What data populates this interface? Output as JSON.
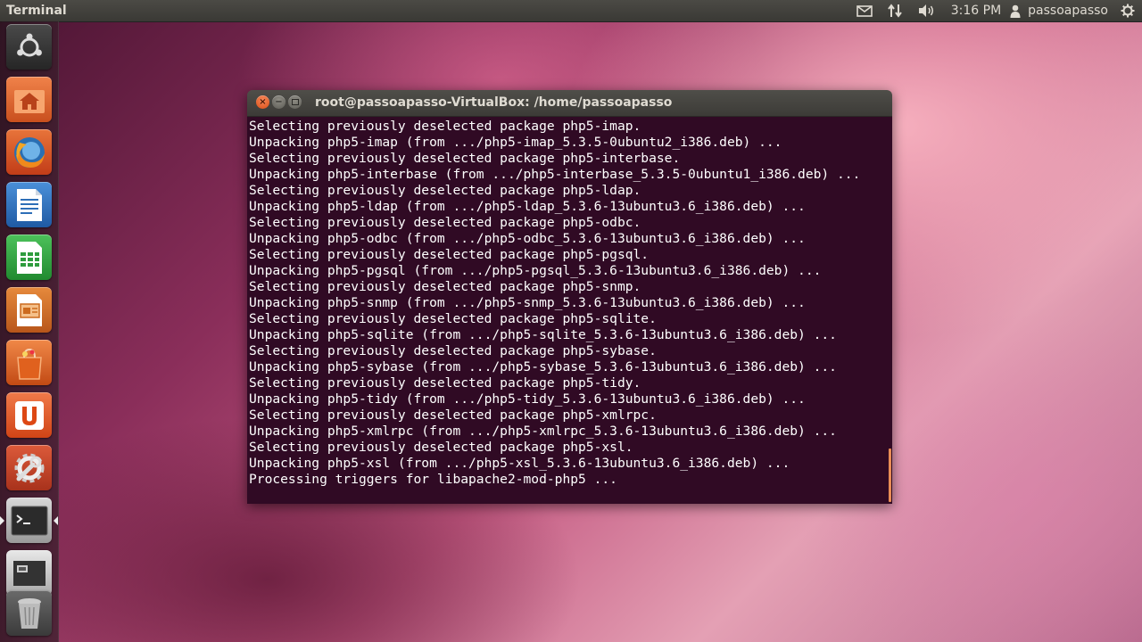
{
  "top_panel": {
    "app_title": "Terminal",
    "clock": "3:16 PM",
    "user": "passoapasso",
    "icons": [
      "mail-icon",
      "network-icon",
      "volume-icon",
      "user-icon",
      "gear-icon"
    ]
  },
  "launcher": {
    "items": [
      {
        "name": "dash-home",
        "icon": "ubuntu-logo-icon",
        "color": "#2b2b2b"
      },
      {
        "name": "home-folder",
        "icon": "home-folder-icon",
        "color": "#d8652c"
      },
      {
        "name": "firefox",
        "icon": "firefox-icon",
        "color": "#2a6fb3"
      },
      {
        "name": "libreoffice-writer",
        "icon": "writer-icon",
        "color": "#2d6eb7"
      },
      {
        "name": "libreoffice-calc",
        "icon": "calc-icon",
        "color": "#2e9c3e"
      },
      {
        "name": "libreoffice-impress",
        "icon": "impress-icon",
        "color": "#cc6a1d"
      },
      {
        "name": "software-center",
        "icon": "shopping-bag-icon",
        "color": "#d9621e"
      },
      {
        "name": "ubuntu-one",
        "icon": "ubuntu-one-icon",
        "color": "#d9521e"
      },
      {
        "name": "system-settings",
        "icon": "settings-icon",
        "color": "#c8452a"
      },
      {
        "name": "terminal",
        "icon": "terminal-icon",
        "color": "#555"
      },
      {
        "name": "workspace-switcher",
        "icon": "workspaces-icon",
        "color": "#777"
      },
      {
        "name": "trash",
        "icon": "trash-icon",
        "color": "#555"
      }
    ]
  },
  "terminal": {
    "title": "root@passoapasso-VirtualBox: /home/passoapasso",
    "lines": [
      "Selecting previously deselected package php5-imap.",
      "Unpacking php5-imap (from .../php5-imap_5.3.5-0ubuntu2_i386.deb) ...",
      "Selecting previously deselected package php5-interbase.",
      "Unpacking php5-interbase (from .../php5-interbase_5.3.5-0ubuntu1_i386.deb) ...",
      "Selecting previously deselected package php5-ldap.",
      "Unpacking php5-ldap (from .../php5-ldap_5.3.6-13ubuntu3.6_i386.deb) ...",
      "Selecting previously deselected package php5-odbc.",
      "Unpacking php5-odbc (from .../php5-odbc_5.3.6-13ubuntu3.6_i386.deb) ...",
      "Selecting previously deselected package php5-pgsql.",
      "Unpacking php5-pgsql (from .../php5-pgsql_5.3.6-13ubuntu3.6_i386.deb) ...",
      "Selecting previously deselected package php5-snmp.",
      "Unpacking php5-snmp (from .../php5-snmp_5.3.6-13ubuntu3.6_i386.deb) ...",
      "Selecting previously deselected package php5-sqlite.",
      "Unpacking php5-sqlite (from .../php5-sqlite_5.3.6-13ubuntu3.6_i386.deb) ...",
      "Selecting previously deselected package php5-sybase.",
      "Unpacking php5-sybase (from .../php5-sybase_5.3.6-13ubuntu3.6_i386.deb) ...",
      "Selecting previously deselected package php5-tidy.",
      "Unpacking php5-tidy (from .../php5-tidy_5.3.6-13ubuntu3.6_i386.deb) ...",
      "Selecting previously deselected package php5-xmlrpc.",
      "Unpacking php5-xmlrpc (from .../php5-xmlrpc_5.3.6-13ubuntu3.6_i386.deb) ...",
      "Selecting previously deselected package php5-xsl.",
      "Unpacking php5-xsl (from .../php5-xsl_5.3.6-13ubuntu3.6_i386.deb) ...",
      "Processing triggers for libapache2-mod-php5 ..."
    ],
    "colors": {
      "background": "#300a24",
      "text": "#ffffff",
      "scrollbar": "#e98c55"
    }
  }
}
